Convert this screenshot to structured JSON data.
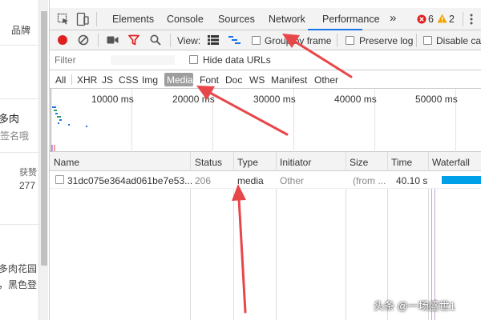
{
  "background_page": {
    "lines": [
      "品牌",
      "多肉",
      "签名哦",
      "获赞",
      "277",
      "多肉花园",
      "，黑色登"
    ]
  },
  "tabs": {
    "elements": "Elements",
    "console": "Console",
    "sources": "Sources",
    "network": "Network",
    "performance": "Performance",
    "more": "»",
    "error_count": "6",
    "warning_count": "2"
  },
  "toolbar": {
    "view_label": "View:",
    "group_by_frame": "Group by frame",
    "preserve_log": "Preserve log",
    "disable_cache": "Disable cach"
  },
  "filter": {
    "placeholder": "Filter",
    "hide_data_urls": "Hide data URLs"
  },
  "types": [
    "All",
    "XHR",
    "JS",
    "CSS",
    "Img",
    "Media",
    "Font",
    "Doc",
    "WS",
    "Manifest",
    "Other"
  ],
  "timeline": {
    "ticks": [
      "10000 ms",
      "20000 ms",
      "30000 ms",
      "40000 ms",
      "50000 ms"
    ]
  },
  "table": {
    "headers": [
      "Name",
      "Status",
      "Type",
      "Initiator",
      "Size",
      "Time",
      "Waterfall"
    ],
    "rows": [
      {
        "name": "31dc075e364ad061be7e53...",
        "status": "206",
        "type": "media",
        "initiator": "Other",
        "size": "(from ...",
        "time": "40.10 s"
      }
    ]
  },
  "colors": {
    "accent": "#1a73e8",
    "record": "#e0201f",
    "arrow": "#e8474a",
    "waterfall_bar": "#00a0e9"
  },
  "watermark": "头条 @一场盛世1"
}
